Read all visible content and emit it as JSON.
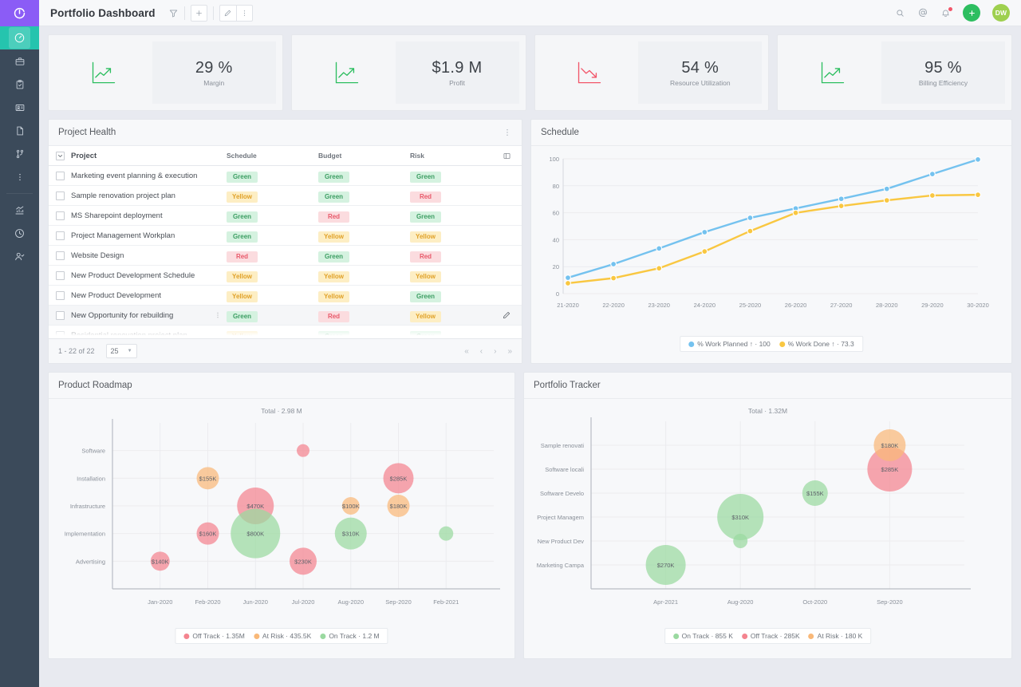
{
  "app": {
    "logo_icon": "circular-arrow-logo",
    "accent_purple": "#8b5cf6",
    "accent_teal": "#25c4ae",
    "sidebar_bg": "#3b4a5a"
  },
  "topbar": {
    "title": "Portfolio Dashboard",
    "filter_icon": "filter-icon",
    "add_label": "+",
    "edit_icon": "pencil-icon",
    "more_icon": "kebab-menu-icon",
    "search_icon": "search-icon",
    "mention_icon": "at-mention-icon",
    "notification_icon": "bell-icon",
    "create_label": "+",
    "avatar_initials": "DW"
  },
  "sidebar": {
    "items": [
      {
        "name": "dashboard",
        "icon": "gauge-icon",
        "active": true
      },
      {
        "name": "portfolio",
        "icon": "briefcase-icon",
        "active": false
      },
      {
        "name": "tasks",
        "icon": "clipboard-check-icon",
        "active": false
      },
      {
        "name": "resources",
        "icon": "id-card-icon",
        "active": false
      },
      {
        "name": "documents",
        "icon": "document-icon",
        "active": false
      },
      {
        "name": "workflow",
        "icon": "branch-icon",
        "active": false
      },
      {
        "name": "more",
        "icon": "kebab-menu-icon",
        "active": false
      },
      {
        "name": "reports",
        "icon": "bar-chart-icon",
        "active": false
      },
      {
        "name": "timesheet",
        "icon": "clock-icon",
        "active": false
      },
      {
        "name": "approvals",
        "icon": "user-check-icon",
        "active": false
      }
    ]
  },
  "kpis": [
    {
      "value": "29 %",
      "label": "Margin",
      "trend": "up",
      "color": "#2dbe60"
    },
    {
      "value": "$1.9 M",
      "label": "Profit",
      "trend": "up",
      "color": "#2dbe60"
    },
    {
      "value": "54 %",
      "label": "Resource Utilization",
      "trend": "down",
      "color": "#f2566a"
    },
    {
      "value": "95 %",
      "label": "Billing Efficiency",
      "trend": "up",
      "color": "#2dbe60"
    }
  ],
  "project_health": {
    "title": "Project Health",
    "kebab_icon": "kebab-menu-icon",
    "columns_icon": "columns-layout-icon",
    "header": [
      "Project",
      "Schedule",
      "Budget",
      "Risk"
    ],
    "rows": [
      {
        "project": "Marketing event planning & execution",
        "schedule": "Green",
        "budget": "Green",
        "risk": "Green"
      },
      {
        "project": "Sample renovation project plan",
        "schedule": "Yellow",
        "budget": "Green",
        "risk": "Red"
      },
      {
        "project": "MS Sharepoint deployment",
        "schedule": "Green",
        "budget": "Red",
        "risk": "Green"
      },
      {
        "project": "Project Management Workplan",
        "schedule": "Green",
        "budget": "Yellow",
        "risk": "Yellow"
      },
      {
        "project": "Website Design",
        "schedule": "Red",
        "budget": "Green",
        "risk": "Red"
      },
      {
        "project": "New Product Development Schedule",
        "schedule": "Yellow",
        "budget": "Yellow",
        "risk": "Yellow"
      },
      {
        "project": "New Product Development",
        "schedule": "Yellow",
        "budget": "Yellow",
        "risk": "Green"
      },
      {
        "project": "New Opportunity for rebuilding",
        "schedule": "Green",
        "budget": "Red",
        "risk": "Yellow"
      },
      {
        "project": "Residential renovation project plan",
        "schedule": "Yellow",
        "budget": "Green",
        "risk": "Green"
      }
    ],
    "footer": {
      "range": "1 - 22 of 22",
      "page_size": "25",
      "first_icon": "«",
      "prev_icon": "‹",
      "next_icon": "›",
      "last_icon": "»"
    }
  },
  "chart_data": [
    {
      "id": "schedule",
      "type": "line",
      "title": "Schedule",
      "xlabel": "",
      "ylabel": "",
      "ylim": [
        0,
        100
      ],
      "yticks": [
        0,
        20,
        40,
        60,
        80,
        100
      ],
      "grid": true,
      "legend_position": "bottom",
      "categories": [
        "21-2020",
        "22-2020",
        "23-2020",
        "24-2020",
        "25-2020",
        "26-2020",
        "27-2020",
        "28-2020",
        "29-2020",
        "30-2020"
      ],
      "series": [
        {
          "name": "% Work Planned ↑ · 100",
          "legend": "% Work Planned ↑ · 100",
          "color": "#74c2ef",
          "values": [
            11.8,
            21.9,
            33.5,
            45.6,
            56.2,
            63.2,
            70.3,
            77.7,
            88.7,
            99.5
          ]
        },
        {
          "name": "% Work Done ↑ · 73.3",
          "legend": "% Work Done ↑ · 73.3",
          "color": "#f9c741",
          "values": [
            7.7,
            11.5,
            18.8,
            31.3,
            46.4,
            59.9,
            65.0,
            69.2,
            72.8,
            73.3
          ]
        }
      ]
    },
    {
      "id": "product-roadmap",
      "type": "scatter",
      "title": "Product Roadmap",
      "total": "Total · 2.98 M",
      "grid": true,
      "legend_position": "bottom",
      "xticks": [
        "Jan-2020",
        "Feb-2020",
        "Jun-2020",
        "Jul-2020",
        "Aug-2020",
        "Sep-2020",
        "Feb-2021"
      ],
      "yticks": [
        "Advertising",
        "Implementation",
        "Infrastructure",
        "Installation",
        "Software"
      ],
      "legend": [
        {
          "label": "Off Track · 1.35M",
          "color": "#f4848f"
        },
        {
          "label": "At Risk · 435.5K",
          "color": "#f9b878"
        },
        {
          "label": "On Track · 1.2 M",
          "color": "#9ad9a0"
        }
      ],
      "bubbles": [
        {
          "label": "$140K",
          "x": "Jan-2020",
          "y": "Advertising",
          "r": 12,
          "color": "#f4848f",
          "status": "Off Track"
        },
        {
          "label": "$160K",
          "x": "Feb-2020",
          "y": "Implementation",
          "r": 14,
          "color": "#f4848f",
          "status": "Off Track"
        },
        {
          "label": "$155K",
          "x": "Feb-2020",
          "y": "Installation",
          "r": 14,
          "color": "#f9b878",
          "status": "At Risk"
        },
        {
          "label": "$470K",
          "x": "Jun-2020",
          "y": "Infrastructure",
          "r": 23,
          "color": "#f4848f",
          "status": "Off Track"
        },
        {
          "label": "$800K",
          "x": "Jun-2020",
          "y": "Implementation",
          "r": 31,
          "color": "#9ad9a0",
          "status": "On Track"
        },
        {
          "label": "$230K",
          "x": "Jul-2020",
          "y": "Advertising",
          "r": 17,
          "color": "#f4848f",
          "status": "Off Track"
        },
        {
          "label": "",
          "x": "Jul-2020",
          "y": "Software",
          "r": 8,
          "color": "#f4848f",
          "status": "Off Track"
        },
        {
          "label": "$310K",
          "x": "Aug-2020",
          "y": "Implementation",
          "r": 20,
          "color": "#9ad9a0",
          "status": "On Track"
        },
        {
          "label": "$100K",
          "x": "Aug-2020",
          "y": "Infrastructure",
          "r": 11,
          "color": "#f9b878",
          "status": "At Risk"
        },
        {
          "label": "$285K",
          "x": "Sep-2020",
          "y": "Installation",
          "r": 19,
          "color": "#f4848f",
          "status": "Off Track"
        },
        {
          "label": "$180K",
          "x": "Sep-2020",
          "y": "Infrastructure",
          "r": 14,
          "color": "#f9b878",
          "status": "At Risk"
        },
        {
          "label": "",
          "x": "Feb-2021",
          "y": "Implementation",
          "r": 9,
          "color": "#9ad9a0",
          "status": "On Track"
        }
      ]
    },
    {
      "id": "portfolio-tracker",
      "type": "scatter",
      "title": "Portfolio Tracker",
      "total": "Total · 1.32M",
      "grid": true,
      "legend_position": "bottom",
      "xticks": [
        "Apr-2021",
        "Aug-2020",
        "Oct-2020",
        "Sep-2020"
      ],
      "yticks": [
        "Marketing Campa",
        "New Product Dev",
        "Project Managem",
        "Software Develo",
        "Software locali",
        "Sample renovati"
      ],
      "legend": [
        {
          "label": "On Track · 855 K",
          "color": "#9ad9a0"
        },
        {
          "label": "Off Track · 285K",
          "color": "#f4848f"
        },
        {
          "label": "At Risk · 180 K",
          "color": "#f9b878"
        }
      ],
      "bubbles": [
        {
          "label": "$270K",
          "x": "Apr-2021",
          "y": "Marketing Campa",
          "r": 25,
          "color": "#9ad9a0",
          "status": "On Track"
        },
        {
          "label": "$310K",
          "x": "Aug-2020",
          "y": "Project Managem",
          "r": 29,
          "color": "#9ad9a0",
          "status": "On Track"
        },
        {
          "label": "",
          "x": "Aug-2020",
          "y": "New Product Dev",
          "r": 9,
          "color": "#9ad9a0",
          "status": "On Track"
        },
        {
          "label": "$155K",
          "x": "Oct-2020",
          "y": "Software Develo",
          "r": 16,
          "color": "#9ad9a0",
          "status": "On Track"
        },
        {
          "label": "$285K",
          "x": "Sep-2020",
          "y": "Software locali",
          "r": 28,
          "color": "#f4848f",
          "status": "Off Track"
        },
        {
          "label": "$180K",
          "x": "Sep-2020",
          "y": "Sample renovati",
          "r": 20,
          "color": "#f9b878",
          "status": "At Risk"
        }
      ]
    }
  ]
}
